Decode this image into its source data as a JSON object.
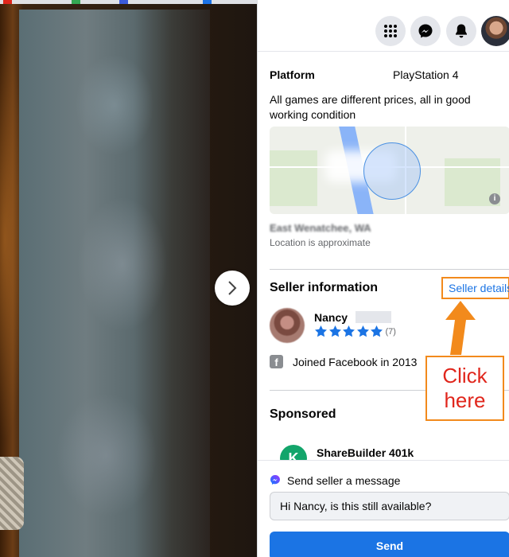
{
  "details": {
    "platform_label": "Platform",
    "platform_value": "PlayStation 4",
    "description": "All games are different prices, all in good working condition"
  },
  "location": {
    "name": "East Wenatchee, WA",
    "note": "Location is approximate",
    "map_info_glyph": "i"
  },
  "seller": {
    "section_title": "Seller information",
    "details_link": "Seller details",
    "name": "Nancy",
    "rating_stars": 5,
    "rating_count": "(7)",
    "joined": "Joined Facebook in 2013"
  },
  "sponsored": {
    "title": "Sponsored",
    "ad_logo_letter": "K",
    "ad_name": "ShareBuilder 401k"
  },
  "message": {
    "title": "Send seller a message",
    "input_value": "Hi Nancy, is this still available?",
    "send_label": "Send"
  },
  "annotation": {
    "callout_line1": "Click",
    "callout_line2": "here",
    "color": "#f28a1c",
    "text_color": "#e0261c"
  },
  "topbar": {
    "icons": [
      "menu-grid-icon",
      "messenger-icon",
      "notifications-bell-icon",
      "profile-avatar"
    ]
  },
  "colors": {
    "link": "#1b74e4",
    "send_button": "#1b74e4",
    "ad_logo": "#13a56b"
  }
}
